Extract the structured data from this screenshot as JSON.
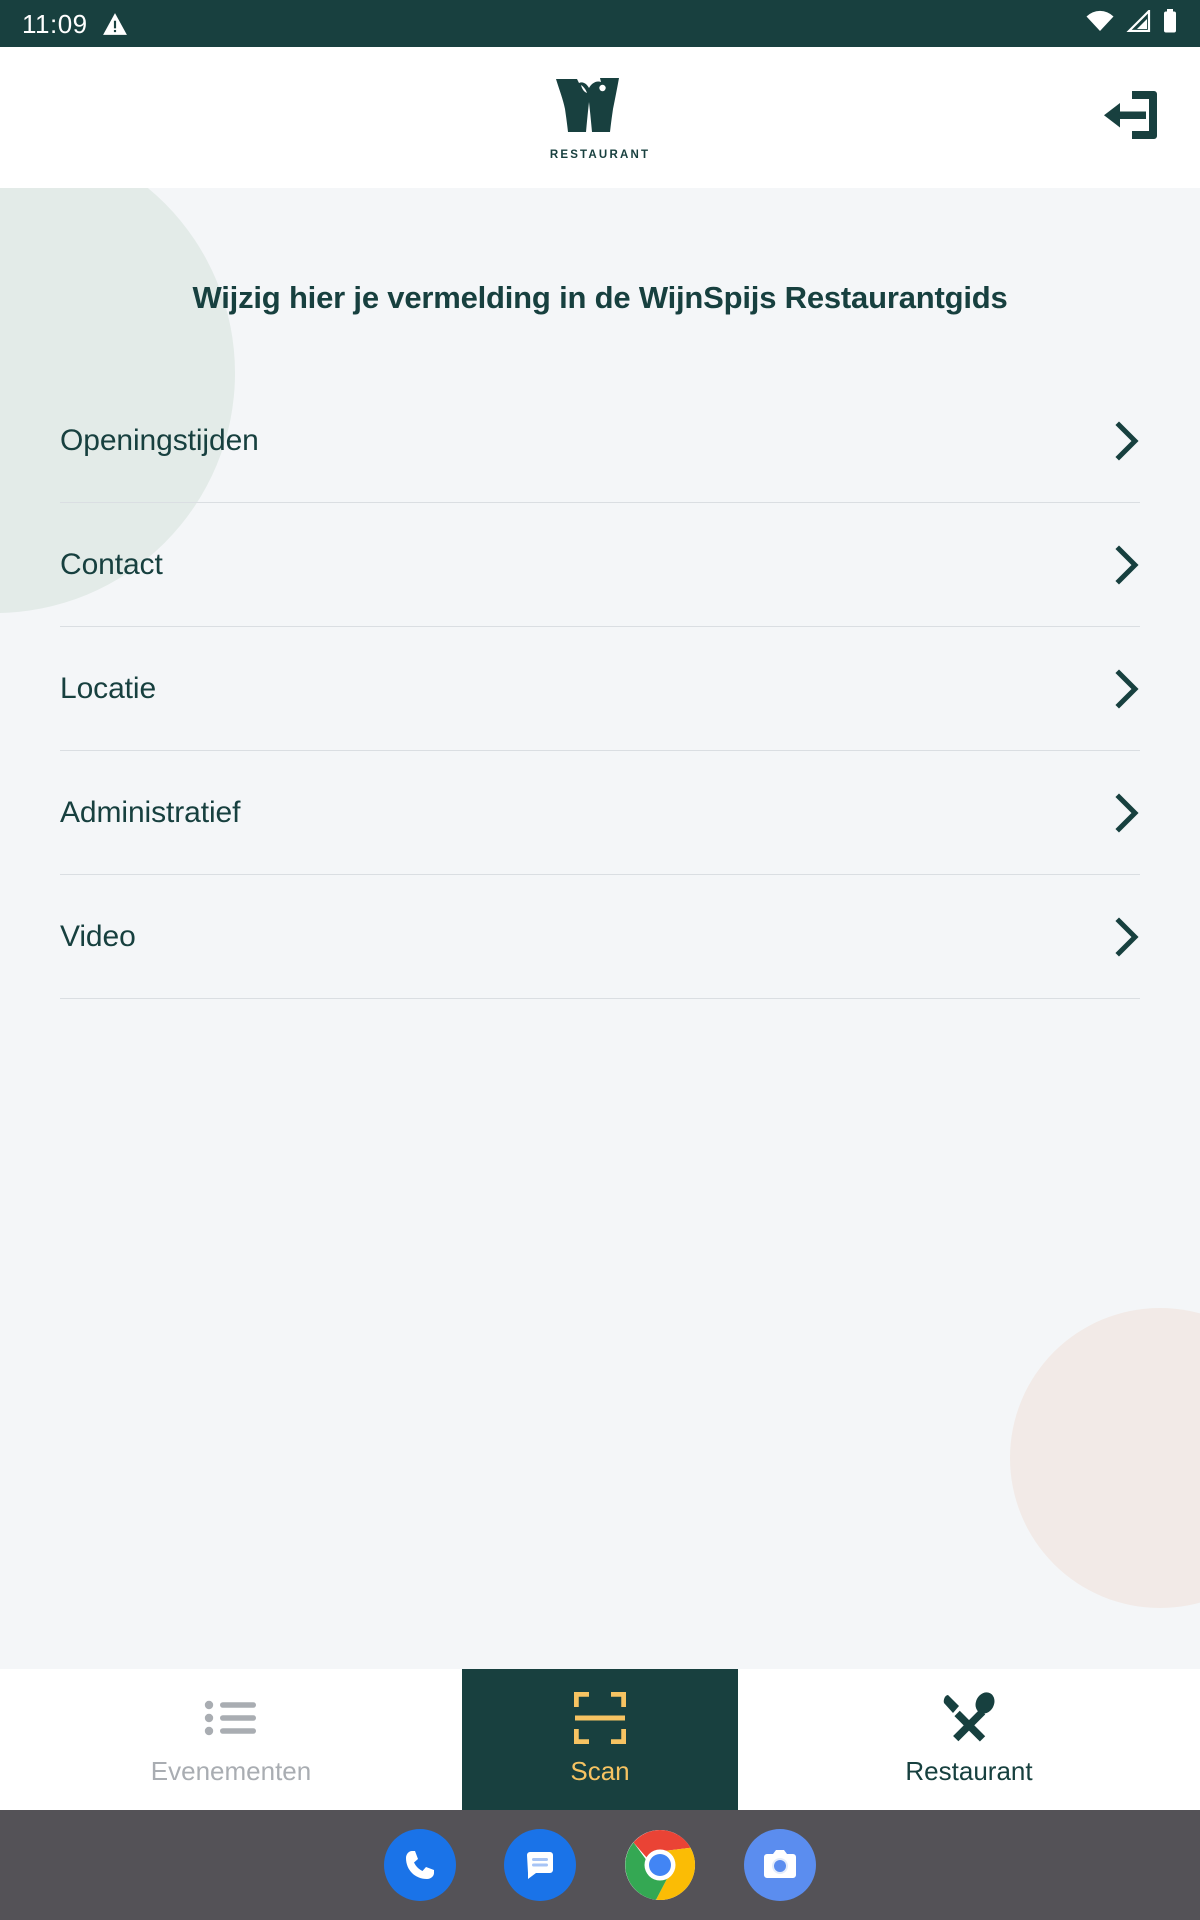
{
  "status_bar": {
    "time": "11:09",
    "icons": [
      "warning-triangle-icon",
      "wifi-icon",
      "cellular-signal-icon",
      "battery-icon"
    ],
    "background_color": "#18403f",
    "foreground_color": "#ffffff"
  },
  "app_header": {
    "logo_name": "wijnspijs-w-logo",
    "wordmark": "RESTAURANT",
    "logout_icon": "logout-icon",
    "background_color": "#ffffff",
    "brand_color": "#18403f"
  },
  "main": {
    "title": "Wijzig hier je vermelding in de WijnSpijs Restaurantgids",
    "background_color": "#f4f6f8",
    "decor": {
      "mint_circle_color": "#dfe9e5",
      "pink_circle_color": "#f2e9e4"
    },
    "menu_items": [
      {
        "label": "Openingstijden",
        "chevron": "chevron-right-icon"
      },
      {
        "label": "Contact",
        "chevron": "chevron-right-icon"
      },
      {
        "label": "Locatie",
        "chevron": "chevron-right-icon"
      },
      {
        "label": "Administratief",
        "chevron": "chevron-right-icon"
      },
      {
        "label": "Video",
        "chevron": "chevron-right-icon"
      }
    ]
  },
  "tab_bar": {
    "active_index": 1,
    "active_background": "#18403f",
    "active_accent": "#f6c362",
    "tabs": [
      {
        "label": "Evenementen",
        "icon": "list-bullets-icon",
        "state": "inactive"
      },
      {
        "label": "Scan",
        "icon": "scan-frame-icon",
        "state": "active"
      },
      {
        "label": "Restaurant",
        "icon": "cutlery-icon",
        "state": "inactive"
      }
    ]
  },
  "android_dock": {
    "background_color": "#545257",
    "apps": [
      {
        "name": "phone-icon",
        "color": "#1a73e8"
      },
      {
        "name": "messages-icon",
        "color": "#1a73e8"
      },
      {
        "name": "chrome-icon",
        "color": "#4285f4"
      },
      {
        "name": "camera-icon",
        "color": "#5b8def"
      }
    ]
  }
}
